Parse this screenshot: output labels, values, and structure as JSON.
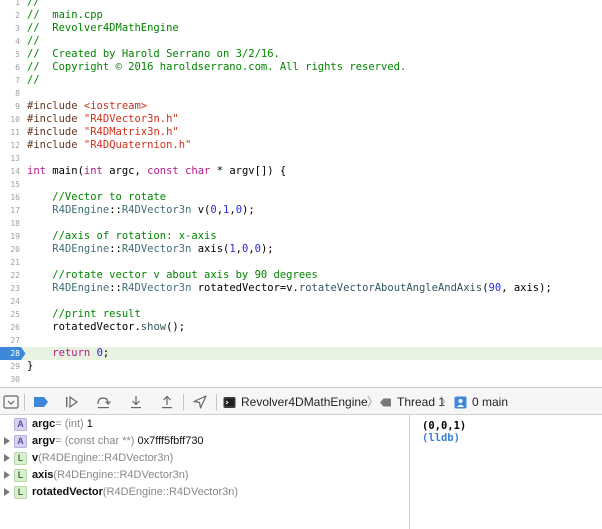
{
  "editor": {
    "lines": [
      {
        "n": "1",
        "parts": [
          {
            "t": "//",
            "c": "com"
          }
        ]
      },
      {
        "n": "2",
        "parts": [
          {
            "t": "//  main.cpp",
            "c": "com"
          }
        ]
      },
      {
        "n": "3",
        "parts": [
          {
            "t": "//  Revolver4DMathEngine",
            "c": "com"
          }
        ]
      },
      {
        "n": "4",
        "parts": [
          {
            "t": "//",
            "c": "com"
          }
        ]
      },
      {
        "n": "5",
        "parts": [
          {
            "t": "//  Created by Harold Serrano on 3/2/16.",
            "c": "com"
          }
        ]
      },
      {
        "n": "6",
        "parts": [
          {
            "t": "//  Copyright © 2016 haroldserrano.com. All rights reserved.",
            "c": "com"
          }
        ]
      },
      {
        "n": "7",
        "parts": [
          {
            "t": "//",
            "c": "com"
          }
        ]
      },
      {
        "n": "8",
        "parts": []
      },
      {
        "n": "9",
        "parts": [
          {
            "t": "#include ",
            "c": "pp"
          },
          {
            "t": "<iostream>",
            "c": "str"
          }
        ]
      },
      {
        "n": "10",
        "parts": [
          {
            "t": "#include ",
            "c": "pp"
          },
          {
            "t": "\"R4DVector3n.h\"",
            "c": "str"
          }
        ]
      },
      {
        "n": "11",
        "parts": [
          {
            "t": "#include ",
            "c": "pp"
          },
          {
            "t": "\"R4DMatrix3n.h\"",
            "c": "str"
          }
        ]
      },
      {
        "n": "12",
        "parts": [
          {
            "t": "#include ",
            "c": "pp"
          },
          {
            "t": "\"R4DQuaternion.h\"",
            "c": "str"
          }
        ]
      },
      {
        "n": "13",
        "parts": []
      },
      {
        "n": "14",
        "parts": [
          {
            "t": "int",
            "c": "kw"
          },
          {
            "t": " main(",
            "c": ""
          },
          {
            "t": "int",
            "c": "kw"
          },
          {
            "t": " argc, ",
            "c": ""
          },
          {
            "t": "const",
            "c": "kw"
          },
          {
            "t": " ",
            "c": ""
          },
          {
            "t": "char",
            "c": "kw"
          },
          {
            "t": " * argv[]) {",
            "c": ""
          }
        ]
      },
      {
        "n": "15",
        "parts": []
      },
      {
        "n": "16",
        "parts": [
          {
            "t": "    //Vector to rotate",
            "c": "com"
          }
        ]
      },
      {
        "n": "17",
        "parts": [
          {
            "t": "    ",
            "c": ""
          },
          {
            "t": "R4DEngine",
            "c": "type"
          },
          {
            "t": "::",
            "c": ""
          },
          {
            "t": "R4DVector3n",
            "c": "type"
          },
          {
            "t": " v(",
            "c": ""
          },
          {
            "t": "0",
            "c": "num"
          },
          {
            "t": ",",
            "c": ""
          },
          {
            "t": "1",
            "c": "num"
          },
          {
            "t": ",",
            "c": ""
          },
          {
            "t": "0",
            "c": "num"
          },
          {
            "t": ");",
            "c": ""
          }
        ]
      },
      {
        "n": "18",
        "parts": []
      },
      {
        "n": "19",
        "parts": [
          {
            "t": "    //axis of rotation: x-axis",
            "c": "com"
          }
        ]
      },
      {
        "n": "20",
        "parts": [
          {
            "t": "    ",
            "c": ""
          },
          {
            "t": "R4DEngine",
            "c": "type"
          },
          {
            "t": "::",
            "c": ""
          },
          {
            "t": "R4DVector3n",
            "c": "type"
          },
          {
            "t": " axis(",
            "c": ""
          },
          {
            "t": "1",
            "c": "num"
          },
          {
            "t": ",",
            "c": ""
          },
          {
            "t": "0",
            "c": "num"
          },
          {
            "t": ",",
            "c": ""
          },
          {
            "t": "0",
            "c": "num"
          },
          {
            "t": ");",
            "c": ""
          }
        ]
      },
      {
        "n": "21",
        "parts": []
      },
      {
        "n": "22",
        "parts": [
          {
            "t": "    //rotate vector v about axis by 90 degrees",
            "c": "com"
          }
        ]
      },
      {
        "n": "23",
        "parts": [
          {
            "t": "    ",
            "c": ""
          },
          {
            "t": "R4DEngine",
            "c": "type"
          },
          {
            "t": "::",
            "c": ""
          },
          {
            "t": "R4DVector3n",
            "c": "type"
          },
          {
            "t": " rotatedVector=v.",
            "c": ""
          },
          {
            "t": "rotateVectorAboutAngleAndAxis",
            "c": "fn"
          },
          {
            "t": "(",
            "c": ""
          },
          {
            "t": "90",
            "c": "num"
          },
          {
            "t": ", axis);",
            "c": ""
          }
        ]
      },
      {
        "n": "24",
        "parts": []
      },
      {
        "n": "25",
        "parts": [
          {
            "t": "    //print result",
            "c": "com"
          }
        ]
      },
      {
        "n": "26",
        "parts": [
          {
            "t": "    rotatedVector.",
            "c": ""
          },
          {
            "t": "show",
            "c": "fn"
          },
          {
            "t": "();",
            "c": ""
          }
        ]
      },
      {
        "n": "27",
        "parts": []
      },
      {
        "n": "28",
        "parts": [
          {
            "t": "    ",
            "c": ""
          },
          {
            "t": "return",
            "c": "kw"
          },
          {
            "t": " ",
            "c": ""
          },
          {
            "t": "0",
            "c": "num"
          },
          {
            "t": ";",
            "c": ""
          }
        ],
        "current": true
      },
      {
        "n": "29",
        "parts": [
          {
            "t": "}",
            "c": ""
          }
        ]
      },
      {
        "n": "30",
        "parts": []
      }
    ],
    "breakpoint_color": "#3f87d9",
    "current_line_color": "#e8f2e0"
  },
  "debugbar": {
    "buttons": [
      {
        "name": "hide-debug-area-button",
        "icon": "hide-debug-area-icon"
      },
      {
        "name": "breakpoints-toggle-button",
        "icon": "breakpoint-icon"
      },
      {
        "name": "continue-button",
        "icon": "continue-icon"
      },
      {
        "name": "step-over-button",
        "icon": "step-over-icon"
      },
      {
        "name": "step-into-button",
        "icon": "step-into-icon"
      },
      {
        "name": "step-out-button",
        "icon": "step-out-icon"
      },
      {
        "name": "simulate-location-button",
        "icon": "location-arrow-icon"
      }
    ],
    "breadcrumbs": {
      "target": "Revolver4DMathEngine",
      "thread": "Thread 1",
      "frame": "0 main"
    }
  },
  "variables": [
    {
      "kind": "A",
      "scope": "argument",
      "name": "argc",
      "rest": " = (int) ",
      "value": "1",
      "expandable": false
    },
    {
      "kind": "A",
      "scope": "argument",
      "name": "argv",
      "rest": " = (const char **) ",
      "value": "0x7fff5fbff730",
      "expandable": true
    },
    {
      "kind": "L",
      "scope": "local",
      "name": "v",
      "rest": " (R4DEngine::R4DVector3n)",
      "value": "",
      "expandable": true
    },
    {
      "kind": "L",
      "scope": "local",
      "name": "axis",
      "rest": " (R4DEngine::R4DVector3n)",
      "value": "",
      "expandable": true
    },
    {
      "kind": "L",
      "scope": "local",
      "name": "rotatedVector",
      "rest": " (R4DEngine::R4DVector3n)",
      "value": "",
      "expandable": true
    }
  ],
  "console": {
    "lines": [
      {
        "text": "(0,0,1)",
        "color": "#000000"
      },
      {
        "text": "(lldb)",
        "color": "#3c7fd8"
      }
    ]
  }
}
